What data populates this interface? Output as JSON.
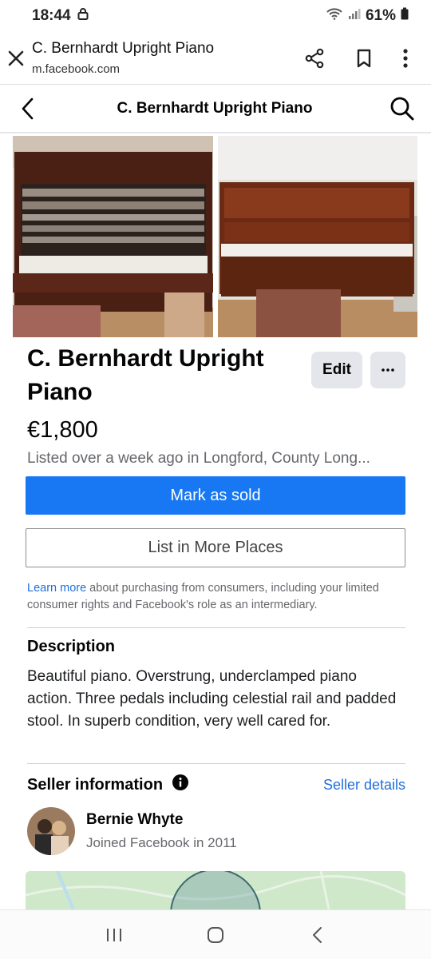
{
  "status_bar": {
    "time": "18:44",
    "battery": "61%"
  },
  "browser": {
    "title": "C. Bernhardt Upright Piano",
    "url": "m.facebook.com"
  },
  "header": {
    "title": "C. Bernhardt Upright Piano"
  },
  "listing": {
    "title": "C. Bernhardt Upright Piano",
    "edit_label": "Edit",
    "price": "€1,800",
    "listed": "Listed over a week ago in Longford, County Long..."
  },
  "actions": {
    "primary": "Mark as sold",
    "secondary": "List in More Places"
  },
  "disclaimer": {
    "link": "Learn more",
    "text": " about purchasing from consumers, including your limited consumer rights and Facebook's role as an intermediary."
  },
  "description": {
    "heading": "Description",
    "text": "Beautiful piano. Overstrung, underclamped  piano action. Three pedals including celestial rail and padded stool. In superb condition, very well cared for."
  },
  "seller": {
    "heading": "Seller information",
    "details_link": "Seller details",
    "name": "Bernie Whyte",
    "joined": "Joined Facebook in 2011"
  },
  "colors": {
    "primary": "#1877f2",
    "link": "#216fdb",
    "secondary_text": "#65676b",
    "button_grey": "#e4e6eb"
  }
}
